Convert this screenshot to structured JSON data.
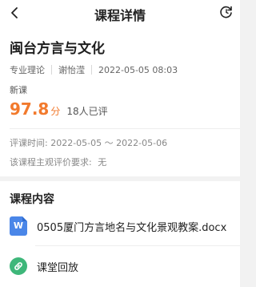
{
  "nav": {
    "title": "课程详情",
    "back_icon": "chevron-left-icon",
    "refresh_icon": "refresh-icon"
  },
  "course": {
    "title": "闽台方言与文化",
    "category": "专业理论",
    "teacher": "谢怡滢",
    "datetime": "2022-05-05 08:03",
    "tag": "新课",
    "score": "97.8",
    "score_unit": "分",
    "reviewers": "18人已评",
    "review_period_label": "评课时间:",
    "review_period_value": "2022-05-05 ～ 2022-05-06",
    "subjective_label": "该课程主观评价要求:",
    "subjective_value": "无"
  },
  "content": {
    "section_title": "课程内容",
    "items": [
      {
        "label": "0505厦门方言地名与文化景观教案.docx",
        "icon": "word-doc-icon",
        "badge": "W"
      },
      {
        "label": "课堂回放",
        "icon": "link-icon"
      }
    ]
  },
  "colors": {
    "accent": "#f27a2d",
    "doc_blue": "#4a86e8",
    "link_green": "#3eb77a"
  }
}
